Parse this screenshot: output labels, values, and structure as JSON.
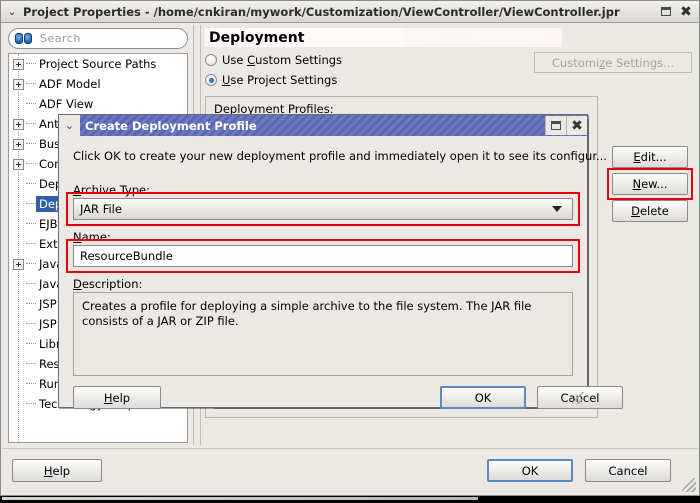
{
  "window": {
    "title": "Project Properties - /home/cnkiran/mywork/Customization/ViewController/ViewController.jpr",
    "menu_glyph": "⌄",
    "restore_label": "restore-window",
    "close_glyph": "✖"
  },
  "search": {
    "placeholder": "Search",
    "icon": "binoculars-icon"
  },
  "tree": {
    "items": [
      {
        "label": "Project Source Paths",
        "expandable": true,
        "selected": false
      },
      {
        "label": "ADF Model",
        "expandable": true,
        "selected": false
      },
      {
        "label": "ADF View",
        "expandable": false,
        "selected": false
      },
      {
        "label": "Ant",
        "expandable": true,
        "selected": false
      },
      {
        "label": "Business Components",
        "expandable": true,
        "selected": false
      },
      {
        "label": "Compiler",
        "expandable": true,
        "selected": false
      },
      {
        "label": "Dependencies",
        "expandable": false,
        "selected": false
      },
      {
        "label": "Deployment",
        "expandable": false,
        "selected": true
      },
      {
        "label": "EJB Module",
        "expandable": false,
        "selected": false
      },
      {
        "label": "Extension",
        "expandable": false,
        "selected": false
      },
      {
        "label": "Java EE Application",
        "expandable": true,
        "selected": false
      },
      {
        "label": "Javadoc",
        "expandable": false,
        "selected": false
      },
      {
        "label": "JSP Tag Libraries",
        "expandable": false,
        "selected": false
      },
      {
        "label": "JSP Visual Editor",
        "expandable": false,
        "selected": false
      },
      {
        "label": "Libraries and Classpath",
        "expandable": false,
        "selected": false
      },
      {
        "label": "Resource Bundle",
        "expandable": false,
        "selected": false
      },
      {
        "label": "Run/Debug/Profile",
        "expandable": false,
        "selected": false
      },
      {
        "label": "Technology Scope",
        "expandable": false,
        "selected": false
      }
    ]
  },
  "main": {
    "page_title": "Deployment",
    "radio_custom": "Use Custom Settings",
    "radio_project": "Use Project Settings",
    "radio_selected": "Use Project Settings",
    "customize_button": "Customize Settings...",
    "profiles_label": "Deployment Profiles:",
    "buttons": {
      "edit": "Edit...",
      "new": "New...",
      "delete": "Delete"
    }
  },
  "footer": {
    "help": "Help",
    "ok": "OK",
    "cancel": "Cancel"
  },
  "dialog": {
    "title": "Create Deployment Profile",
    "menu_glyph": "⌄",
    "close_glyph": "✖",
    "intro": "Click OK to create your new deployment profile and immediately open it to see its configur...",
    "archive_label": "Archive Type:",
    "archive_value": "JAR File",
    "name_label": "Name:",
    "name_value": "ResourceBundle",
    "description_label": "Description:",
    "description_text": "Creates a profile for deploying a simple archive to the file system. The JAR file consists of a JAR or ZIP file.",
    "help": "Help",
    "ok": "OK",
    "cancel": "Cancel"
  },
  "colors": {
    "highlight_red": "#e8000c",
    "selection_blue": "#2f5fa8",
    "dialog_title_blue": "#5a68b4",
    "window_bg": "#ece9e4"
  }
}
